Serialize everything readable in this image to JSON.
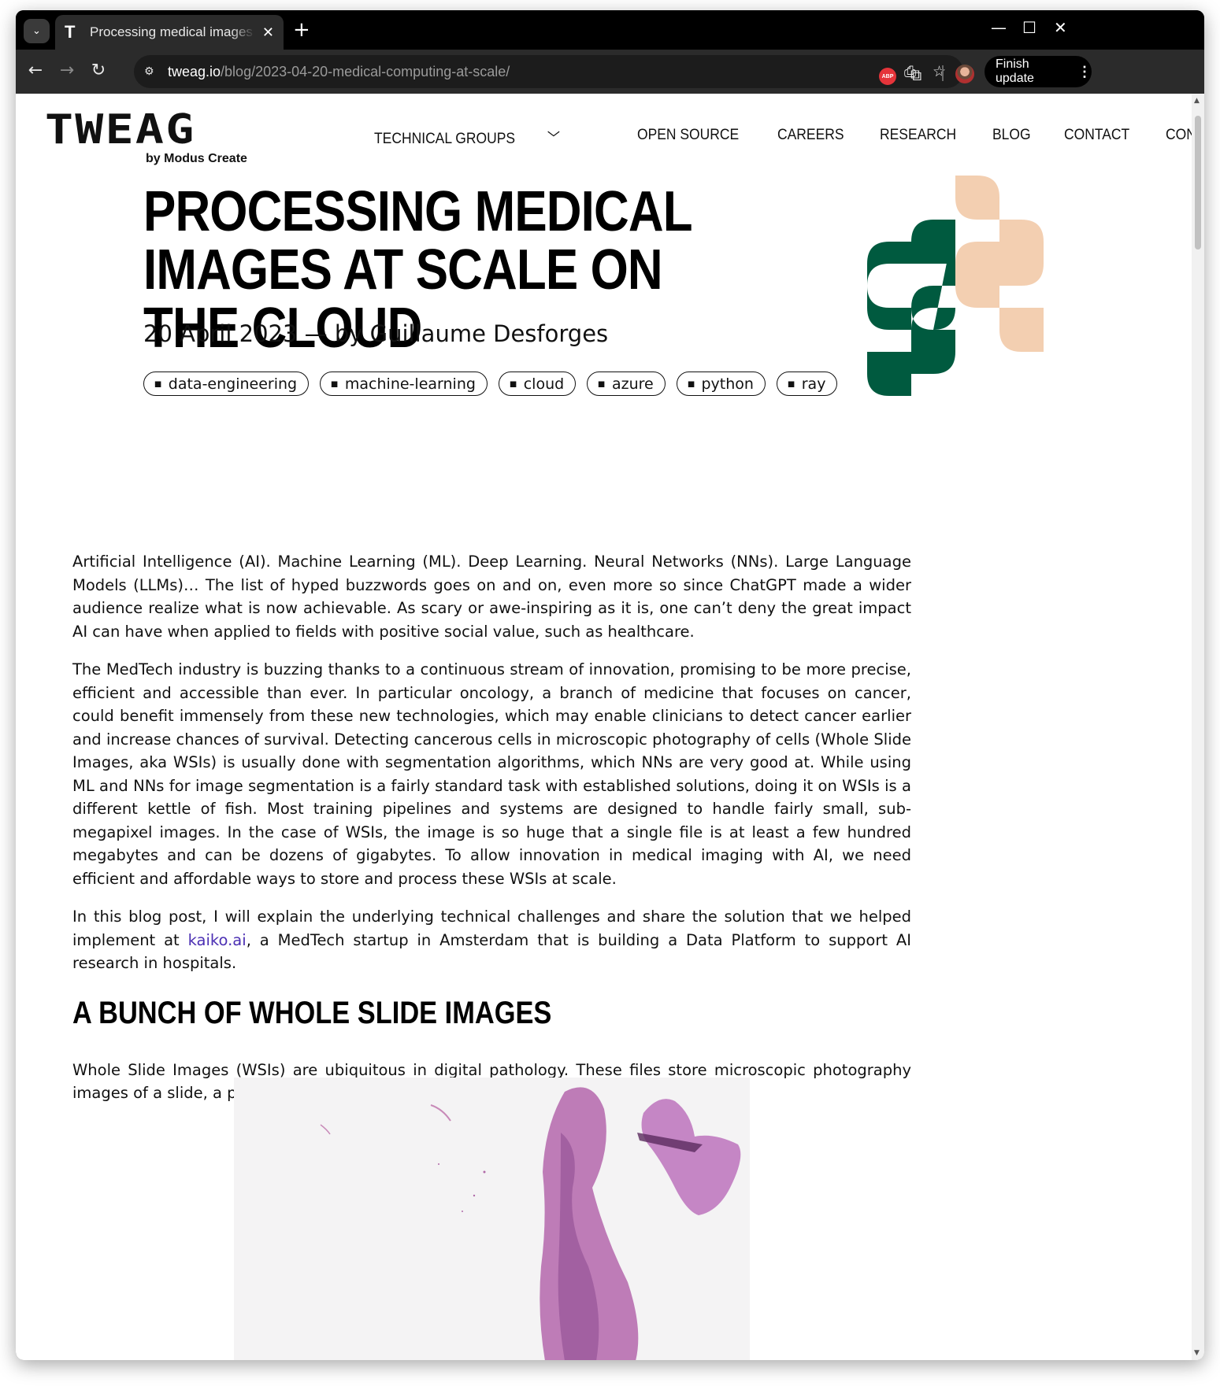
{
  "browser": {
    "tab_title": "Processing medical images at scale on the cloud",
    "url_host": "tweag.io",
    "url_path": "/blog/2023-04-20-medical-computing-at-scale/",
    "extension_badge": "ABP",
    "update_label": "Finish update"
  },
  "site": {
    "logo_text": "TWEAG",
    "logo_sub": "by Modus Create",
    "nav": [
      "TECHNICAL GROUPS",
      "OPEN SOURCE",
      "CAREERS",
      "RESEARCH",
      "BLOG",
      "CONTACT",
      "CONSULTING SERVICES"
    ]
  },
  "hero": {
    "title": "PROCESSING MEDICAL IMAGES AT SCALE ON THE CLOUD",
    "byline": "20 April 2023 — by Guillaume Desforges",
    "tags": [
      "data-engineering",
      "machine-learning",
      "cloud",
      "azure",
      "python",
      "ray"
    ],
    "colors": {
      "dark_green": "#005a3f",
      "peach": "#f3cfb1"
    }
  },
  "article": {
    "p1": "Artificial Intelligence (AI). Machine Learning (ML). Deep Learning. Neural Networks (NNs). Large Language Models (LLMs)… The list of hyped buzzwords goes on and on, even more so since ChatGPT made a wider audience realize what is now achievable. As scary or awe-inspiring as it is, one can’t deny the great impact AI can have when applied to fields with positive social value, such as healthcare.",
    "p2": "The MedTech industry is buzzing thanks to a continuous stream of innovation, promising to be more precise, efficient and accessible than ever. In particular oncology, a branch of medicine that focuses on cancer, could benefit immensely from these new technologies, which may enable clinicians to detect cancer earlier and increase chances of survival. Detecting cancerous cells in microscopic photography of cells (Whole Slide Images, aka WSIs) is usually done with segmentation algorithms, which NNs are very good at. While using ML and NNs for image segmentation is a fairly standard task with established solutions, doing it on WSIs is a different kettle of fish. Most training pipelines and systems are designed to handle fairly small, sub-megapixel images. In the case of WSIs, the image is so huge that a single file is at least a few hundred megabytes and can be dozens of gigabytes. To allow innovation in medical imaging with AI, we need efficient and affordable ways to store and process these WSIs at scale.",
    "p3_before": "In this blog post, I will explain the underlying technical challenges and share the solution that we helped implement at ",
    "p3_link": "kaiko.ai",
    "p3_after": ", a MedTech startup in Amsterdam that is building a Data Platform to support AI research in hospitals.",
    "h2": "A BUNCH OF WHOLE SLIDE IMAGES",
    "p4": "Whole Slide Images (WSIs) are ubiquitous in digital pathology. These files store microscopic photography images of a slide, a piece of glass with cells on it.",
    "link_color": "#4b2fb3"
  }
}
